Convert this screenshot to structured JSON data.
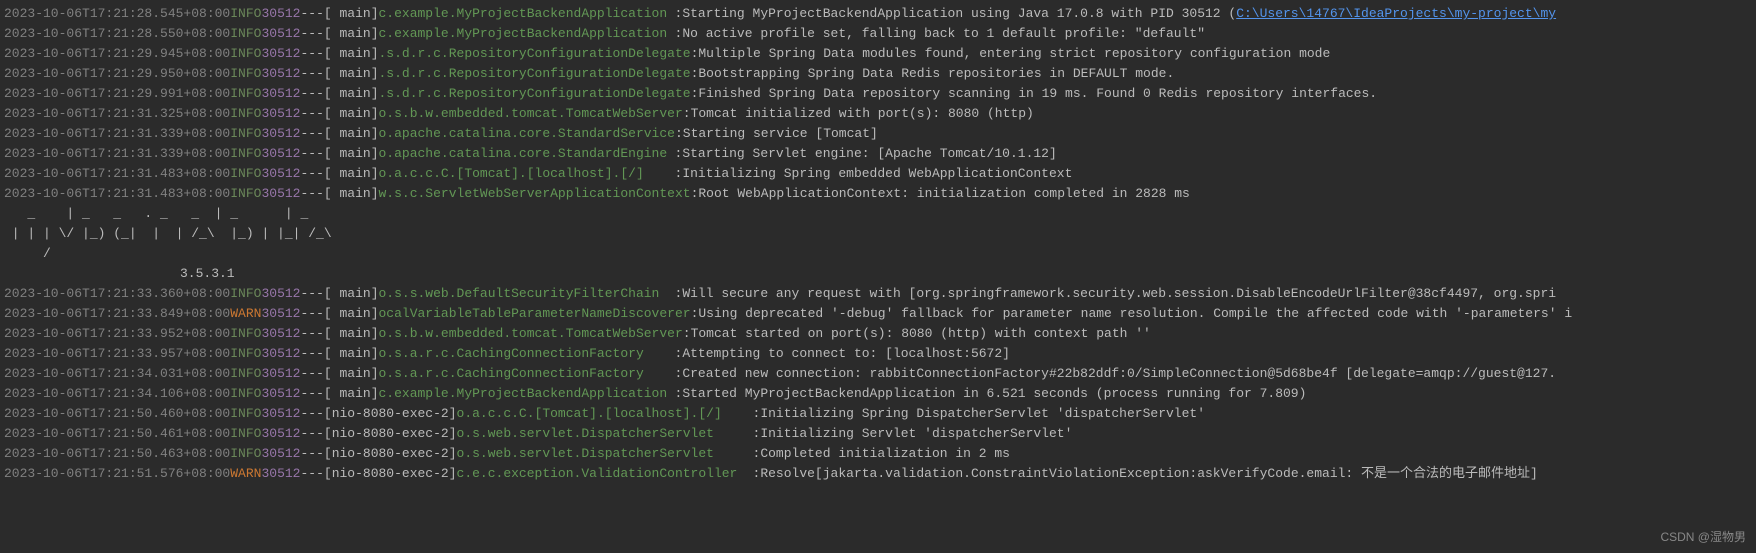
{
  "watermark": "CSDN @湿物男",
  "banner": {
    "lines": [
      "   _    | _   _   . _   _  | _      | _",
      " | | | \\/ |_) (_|  |  | /_\\  |_) | |_| /_\\",
      "     /",
      ""
    ],
    "version": "3.5.3.1"
  },
  "entries": [
    {
      "ts": "2023-10-06T17:21:28.545+08:00",
      "level": "INFO",
      "pid": "30512",
      "thread": "main",
      "logger": "c.example.MyProjectBackendApplication",
      "msg": "Starting MyProjectBackendApplication using Java 17.0.8 with PID 30512 (",
      "link": "C:\\Users\\14767\\IdeaProjects\\my-project\\my"
    },
    {
      "ts": "2023-10-06T17:21:28.550+08:00",
      "level": "INFO",
      "pid": "30512",
      "thread": "main",
      "logger": "c.example.MyProjectBackendApplication",
      "msg": "No active profile set, falling back to 1 default profile: \"default\""
    },
    {
      "ts": "2023-10-06T17:21:29.945+08:00",
      "level": "INFO",
      "pid": "30512",
      "thread": "main",
      "logger": ".s.d.r.c.RepositoryConfigurationDelegate",
      "msg": "Multiple Spring Data modules found, entering strict repository configuration mode"
    },
    {
      "ts": "2023-10-06T17:21:29.950+08:00",
      "level": "INFO",
      "pid": "30512",
      "thread": "main",
      "logger": ".s.d.r.c.RepositoryConfigurationDelegate",
      "msg": "Bootstrapping Spring Data Redis repositories in DEFAULT mode."
    },
    {
      "ts": "2023-10-06T17:21:29.991+08:00",
      "level": "INFO",
      "pid": "30512",
      "thread": "main",
      "logger": ".s.d.r.c.RepositoryConfigurationDelegate",
      "msg": "Finished Spring Data repository scanning in 19 ms. Found 0 Redis repository interfaces."
    },
    {
      "ts": "2023-10-06T17:21:31.325+08:00",
      "level": "INFO",
      "pid": "30512",
      "thread": "main",
      "logger": "o.s.b.w.embedded.tomcat.TomcatWebServer",
      "msg": "Tomcat initialized with port(s): 8080 (http)"
    },
    {
      "ts": "2023-10-06T17:21:31.339+08:00",
      "level": "INFO",
      "pid": "30512",
      "thread": "main",
      "logger": "o.apache.catalina.core.StandardService",
      "msg": "Starting service [Tomcat]"
    },
    {
      "ts": "2023-10-06T17:21:31.339+08:00",
      "level": "INFO",
      "pid": "30512",
      "thread": "main",
      "logger": "o.apache.catalina.core.StandardEngine",
      "msg": "Starting Servlet engine: [Apache Tomcat/10.1.12]"
    },
    {
      "ts": "2023-10-06T17:21:31.483+08:00",
      "level": "INFO",
      "pid": "30512",
      "thread": "main",
      "logger": "o.a.c.c.C.[Tomcat].[localhost].[/]",
      "msg": "Initializing Spring embedded WebApplicationContext"
    },
    {
      "ts": "2023-10-06T17:21:31.483+08:00",
      "level": "INFO",
      "pid": "30512",
      "thread": "main",
      "logger": "w.s.c.ServletWebServerApplicationContext",
      "msg": "Root WebApplicationContext: initialization completed in 2828 ms"
    },
    {
      "ts": "2023-10-06T17:21:33.360+08:00",
      "level": "INFO",
      "pid": "30512",
      "thread": "main",
      "logger": "o.s.s.web.DefaultSecurityFilterChain",
      "msg": "Will secure any request with [org.springframework.security.web.session.DisableEncodeUrlFilter@38cf4497, org.spri"
    },
    {
      "ts": "2023-10-06T17:21:33.849+08:00",
      "level": "WARN",
      "pid": "30512",
      "thread": "main",
      "logger": "ocalVariableTableParameterNameDiscoverer",
      "msg": "Using deprecated '-debug' fallback for parameter name resolution. Compile the affected code with '-parameters' i"
    },
    {
      "ts": "2023-10-06T17:21:33.952+08:00",
      "level": "INFO",
      "pid": "30512",
      "thread": "main",
      "logger": "o.s.b.w.embedded.tomcat.TomcatWebServer",
      "msg": "Tomcat started on port(s): 8080 (http) with context path ''"
    },
    {
      "ts": "2023-10-06T17:21:33.957+08:00",
      "level": "INFO",
      "pid": "30512",
      "thread": "main",
      "logger": "o.s.a.r.c.CachingConnectionFactory",
      "msg": "Attempting to connect to: [localhost:5672]"
    },
    {
      "ts": "2023-10-06T17:21:34.031+08:00",
      "level": "INFO",
      "pid": "30512",
      "thread": "main",
      "logger": "o.s.a.r.c.CachingConnectionFactory",
      "msg": "Created new connection: rabbitConnectionFactory#22b82ddf:0/SimpleConnection@5d68be4f [delegate=amqp://guest@127."
    },
    {
      "ts": "2023-10-06T17:21:34.106+08:00",
      "level": "INFO",
      "pid": "30512",
      "thread": "main",
      "logger": "c.example.MyProjectBackendApplication",
      "msg": "Started MyProjectBackendApplication in 6.521 seconds (process running for 7.809)"
    },
    {
      "ts": "2023-10-06T17:21:50.460+08:00",
      "level": "INFO",
      "pid": "30512",
      "thread": "nio-8080-exec-2",
      "logger": "o.a.c.c.C.[Tomcat].[localhost].[/]",
      "msg": "Initializing Spring DispatcherServlet 'dispatcherServlet'"
    },
    {
      "ts": "2023-10-06T17:21:50.461+08:00",
      "level": "INFO",
      "pid": "30512",
      "thread": "nio-8080-exec-2",
      "logger": "o.s.web.servlet.DispatcherServlet",
      "msg": "Initializing Servlet 'dispatcherServlet'"
    },
    {
      "ts": "2023-10-06T17:21:50.463+08:00",
      "level": "INFO",
      "pid": "30512",
      "thread": "nio-8080-exec-2",
      "logger": "o.s.web.servlet.DispatcherServlet",
      "msg": "Completed initialization in 2 ms"
    },
    {
      "ts": "2023-10-06T17:21:51.576+08:00",
      "level": "WARN",
      "pid": "30512",
      "thread": "nio-8080-exec-2",
      "logger": "c.e.c.exception.ValidationController",
      "msg": "Resolve[jakarta.validation.ConstraintViolationException:askVerifyCode.email: 不是一个合法的电子邮件地址]"
    }
  ]
}
